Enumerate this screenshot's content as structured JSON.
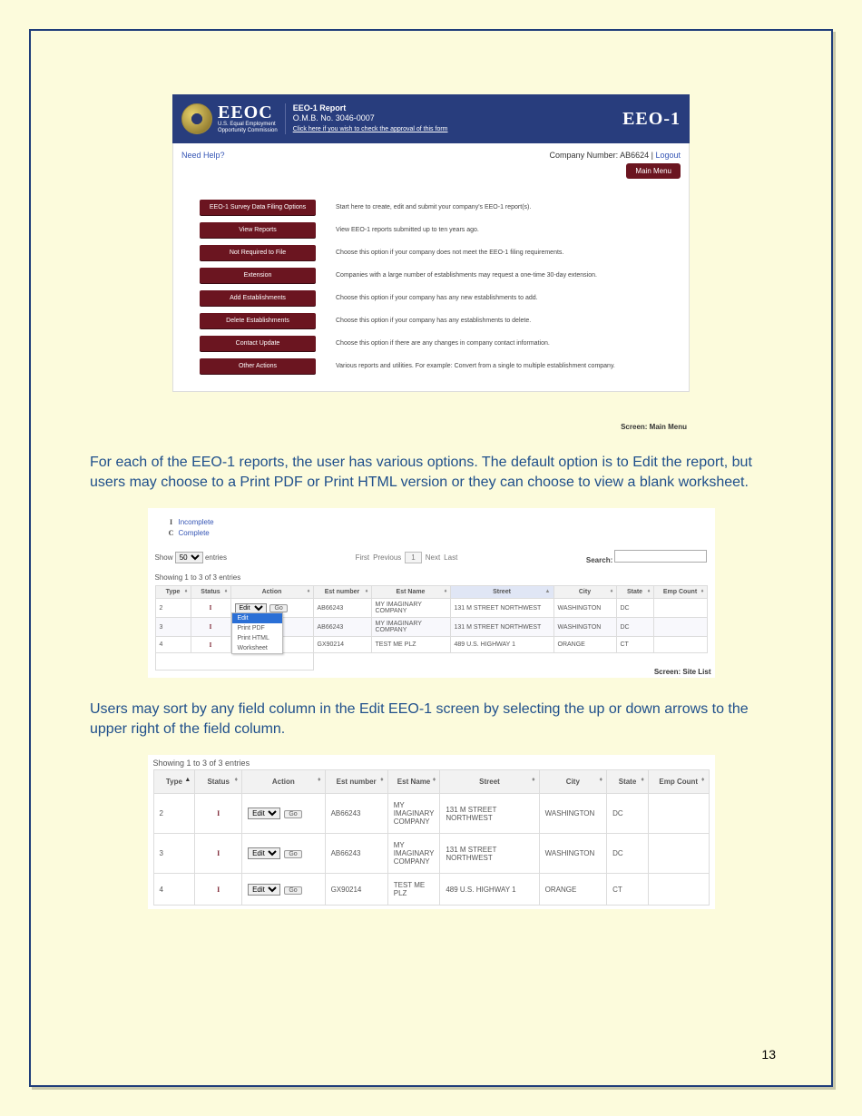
{
  "page_number": "13",
  "shot1": {
    "header": {
      "org_abbr": "EEOC",
      "org_sub1": "U.S. Equal Employment",
      "org_sub2": "Opportunity Commission",
      "report_title": "EEO-1 Report",
      "omb": "O.M.B. No. 3046-0007",
      "approval_link": "Click here if you wish to check the approval of this form",
      "logo_right": "EEO-1"
    },
    "topbar": {
      "need_help": "Need Help?",
      "company_label": "Company Number: ",
      "company_number": "AB6624",
      "sep": " | ",
      "logout": "Logout",
      "main_menu_btn": "Main Menu"
    },
    "menu": [
      {
        "label": "EEO-1 Survey Data Filing Options",
        "desc": "Start here to create, edit and submit your company's EEO-1 report(s)."
      },
      {
        "label": "View Reports",
        "desc": "View EEO-1 reports submitted up to ten years ago."
      },
      {
        "label": "Not Required to File",
        "desc": "Choose this option if your company does not meet the EEO-1 filing requirements."
      },
      {
        "label": "Extension",
        "desc": "Companies with a large number of establishments may request a one-time 30-day extension."
      },
      {
        "label": "Add Establishments",
        "desc": "Choose this option if your company has any new establishments to add."
      },
      {
        "label": "Delete Establishments",
        "desc": "Choose this option if your company has any establishments to delete."
      },
      {
        "label": "Contact Update",
        "desc": "Choose this option if there are any changes in company contact information."
      },
      {
        "label": "Other Actions",
        "desc": "Various reports and utilities. For example: Convert from a single to multiple establishment company."
      }
    ],
    "caption": "Screen: Main Menu"
  },
  "para1": "For each of the EEO-1 reports, the user has various options. The default option is to Edit the report, but users may choose to a Print PDF or Print HTML version or they can choose to view a blank worksheet.",
  "shot2": {
    "legend": [
      {
        "k": "I",
        "v": "Incomplete"
      },
      {
        "k": "C",
        "v": "Complete"
      }
    ],
    "entries_label_pre": "Show ",
    "entries_select": "50",
    "entries_label_post": " entries",
    "pager": {
      "first": "First",
      "previous": "Previous",
      "page": "1",
      "next": "Next",
      "last": "Last"
    },
    "search_label": "Search:",
    "showing": "Showing 1 to 3 of 3 entries",
    "columns": [
      "Type",
      "Status",
      "Action",
      "Est number",
      "Est Name",
      "Street",
      "City",
      "State",
      "Emp Count"
    ],
    "dropdown_options": [
      "Edit",
      "Print PDF",
      "Print HTML",
      "Worksheet"
    ],
    "go": "Go",
    "rows": [
      {
        "type": "2",
        "status": "I",
        "action": "Edit",
        "est_number": "AB66243",
        "est_name": "MY IMAGINARY COMPANY",
        "street": "131 M STREET NORTHWEST",
        "city": "WASHINGTON",
        "state": "DC",
        "emp_count": ""
      },
      {
        "type": "3",
        "status": "I",
        "action": "Edit",
        "est_number": "AB66243",
        "est_name": "MY IMAGINARY COMPANY",
        "street": "131 M STREET NORTHWEST",
        "city": "WASHINGTON",
        "state": "DC",
        "emp_count": ""
      },
      {
        "type": "4",
        "status": "I",
        "action": "Edit",
        "est_number": "GX90214",
        "est_name": "TEST ME PLZ",
        "street": "489 U.S. HIGHWAY 1",
        "city": "ORANGE",
        "state": "CT",
        "emp_count": ""
      }
    ],
    "caption": "Screen: Site List"
  },
  "para2": "Users may sort by any field column in the Edit EEO-1 screen by selecting the up or down arrows to the upper right of the field column.",
  "shot3": {
    "showing": "Showing 1 to 3 of 3 entries",
    "columns": [
      "Type",
      "Status",
      "Action",
      "Est number",
      "Est Name",
      "Street",
      "City",
      "State",
      "Emp Count"
    ],
    "go": "Go",
    "rows": [
      {
        "type": "2",
        "status": "I",
        "action": "Edit",
        "est_number": "AB66243",
        "est_name": "MY IMAGINARY COMPANY",
        "street": "131 M STREET NORTHWEST",
        "city": "WASHINGTON",
        "state": "DC",
        "emp_count": ""
      },
      {
        "type": "3",
        "status": "I",
        "action": "Edit",
        "est_number": "AB66243",
        "est_name": "MY IMAGINARY COMPANY",
        "street": "131 M STREET NORTHWEST",
        "city": "WASHINGTON",
        "state": "DC",
        "emp_count": ""
      },
      {
        "type": "4",
        "status": "I",
        "action": "Edit",
        "est_number": "GX90214",
        "est_name": "TEST ME PLZ",
        "street": "489 U.S. HIGHWAY 1",
        "city": "ORANGE",
        "state": "CT",
        "emp_count": ""
      }
    ]
  }
}
